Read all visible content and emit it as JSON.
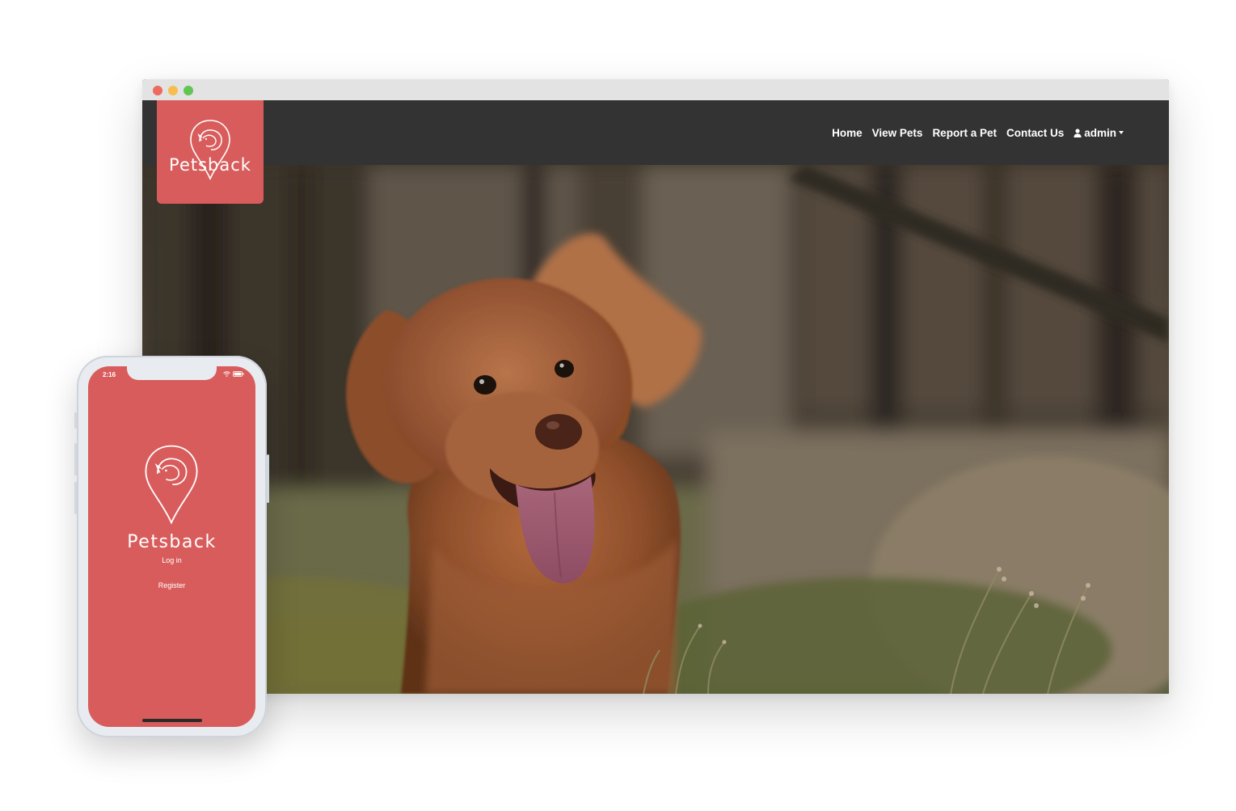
{
  "colors": {
    "brand": "#d95c5c",
    "navbar": "#333333",
    "titlebar": "#e3e3e3"
  },
  "browser": {
    "brand_name": "Petsback",
    "logo_icon": "pet-location-pin-icon",
    "nav": {
      "items": [
        {
          "label": "Home"
        },
        {
          "label": "View Pets"
        },
        {
          "label": "Report a Pet"
        },
        {
          "label": "Contact Us"
        }
      ],
      "user_label": "admin",
      "user_icon": "user-icon",
      "dropdown_icon": "caret-down-icon"
    },
    "hero_image": "dog-photo"
  },
  "phone": {
    "time": "2:16",
    "status_icons": [
      "wifi-icon",
      "battery-icon"
    ],
    "brand_name": "Petsback",
    "login_label": "Log in",
    "register_label": "Register"
  }
}
